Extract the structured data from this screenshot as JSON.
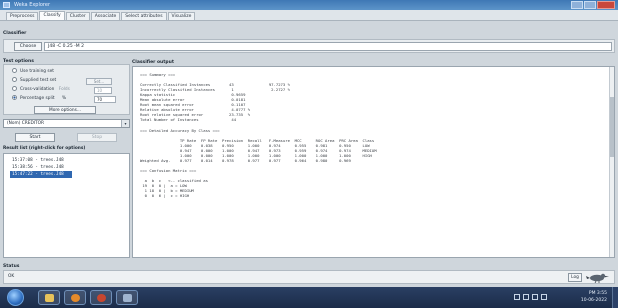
{
  "window": {
    "title": "Weka Explorer"
  },
  "tabs": [
    {
      "label": "Preprocess",
      "active": false
    },
    {
      "label": "Classify",
      "active": true
    },
    {
      "label": "Cluster",
      "active": false
    },
    {
      "label": "Associate",
      "active": false
    },
    {
      "label": "Select attributes",
      "active": false
    },
    {
      "label": "Visualize",
      "active": false
    }
  ],
  "classifier": {
    "section_label": "Classifier",
    "choose_label": "Choose",
    "value": "J48 -C 0.25 -M 2"
  },
  "test_options": {
    "section_label": "Test options",
    "use_training_set": "Use training set",
    "supplied_test_set": "Supplied test set",
    "set_label": "Set...",
    "cross_validation": "Cross-validation",
    "folds_label": "Folds",
    "folds_value": "10",
    "percentage_split": "Percentage split",
    "percent_symbol": "%",
    "percent_value": "70",
    "more_options_label": "More options...",
    "selected": "percentage_split"
  },
  "class_selector": {
    "value": "(Nom) CREDITOR"
  },
  "actions": {
    "start_label": "Start",
    "stop_label": "Stop"
  },
  "result_list": {
    "label": "Result list (right-click for options)",
    "items": [
      {
        "text": "15:37:08 - trees.J48",
        "selected": false
      },
      {
        "text": "15:38:56 - trees.J48",
        "selected": false
      },
      {
        "text": "15:47:22 - trees.J48",
        "selected": true
      }
    ]
  },
  "output": {
    "label": "Classifier output",
    "lines": [
      "=== Summary ===",
      "",
      "Correctly Classified Instances        43               97.7273 %",
      "Incorrectly Classified Instances       1                2.2727 %",
      "Kappa statistic                        0.9659",
      "Mean absolute error                    0.0181",
      "Root mean squared error                0.1107",
      "Relative absolute error                4.0777 %",
      "Root relative squared error           23.735  %",
      "Total Number of Instances              44",
      "",
      "=== Detailed Accuracy By Class ===",
      "",
      "                 TP Rate  FP Rate  Precision  Recall   F-Measure  MCC      ROC Area  PRC Area  Class",
      "                 1.000    0.038    0.950      1.000    0.974      0.955    0.981     0.950     LOW",
      "                 0.947    0.000    1.000      0.947    0.973      0.959    0.974     0.974     MEDIUM",
      "                 1.000    0.000    1.000      1.000    1.000      1.000    1.000     1.000     HIGH",
      "Weighted Avg.    0.977    0.014    0.978      0.977    0.977      0.964    0.980     0.969",
      "",
      "=== Confusion Matrix ===",
      "",
      "  a  b  c   <-- classified as",
      " 19  0  0 |  a = LOW",
      "  1 18  0 |  b = MEDIUM",
      "  0  0  6 |  c = HIGH"
    ]
  },
  "status": {
    "label": "Status",
    "text": "OK",
    "log_label": "Log"
  },
  "taskbar": {
    "time": "PM 3:55",
    "date": "10-06-2022"
  }
}
